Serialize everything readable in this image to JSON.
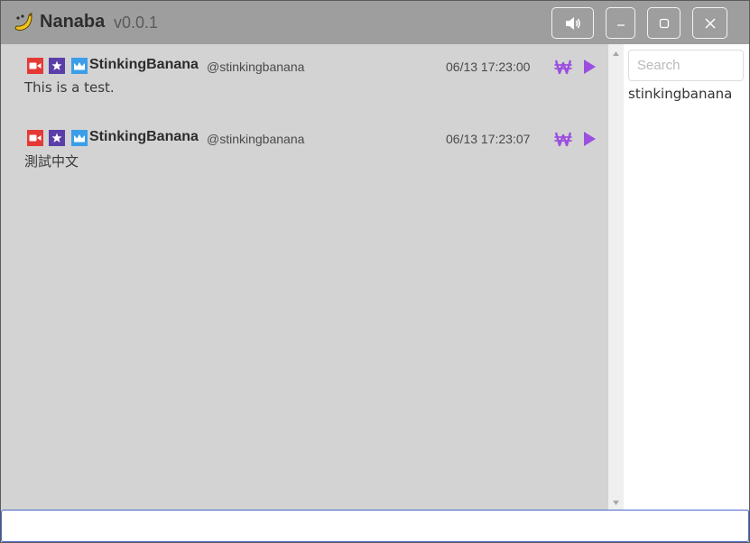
{
  "app": {
    "title": "Nanaba",
    "version": "v0.0.1"
  },
  "titlebar": {
    "buttons": [
      "sound",
      "minimize",
      "maximize",
      "close"
    ]
  },
  "messages": [
    {
      "badges": [
        "video-icon",
        "star-icon",
        "crown-icon"
      ],
      "display_name": "StinkingBanana",
      "handle": "@stinkingbanana",
      "time": "06/13 17:23:00",
      "text": "This is a test."
    },
    {
      "badges": [
        "video-icon",
        "star-icon",
        "crown-icon"
      ],
      "display_name": "StinkingBanana",
      "handle": "@stinkingbanana",
      "time": "06/13 17:23:07",
      "text": "測試中文"
    }
  ],
  "userpanel": {
    "search_placeholder": "Search",
    "users": [
      "stinkingbanana"
    ]
  },
  "colors": {
    "titlebar": "#9e9e9e",
    "chat_background": "#d3d3d3",
    "badge_video": "#e53935",
    "badge_star": "#5b3fa8",
    "badge_crown": "#3b9ee8",
    "action_purple": "#9b4fe0",
    "input_border": "#4a67c9"
  }
}
